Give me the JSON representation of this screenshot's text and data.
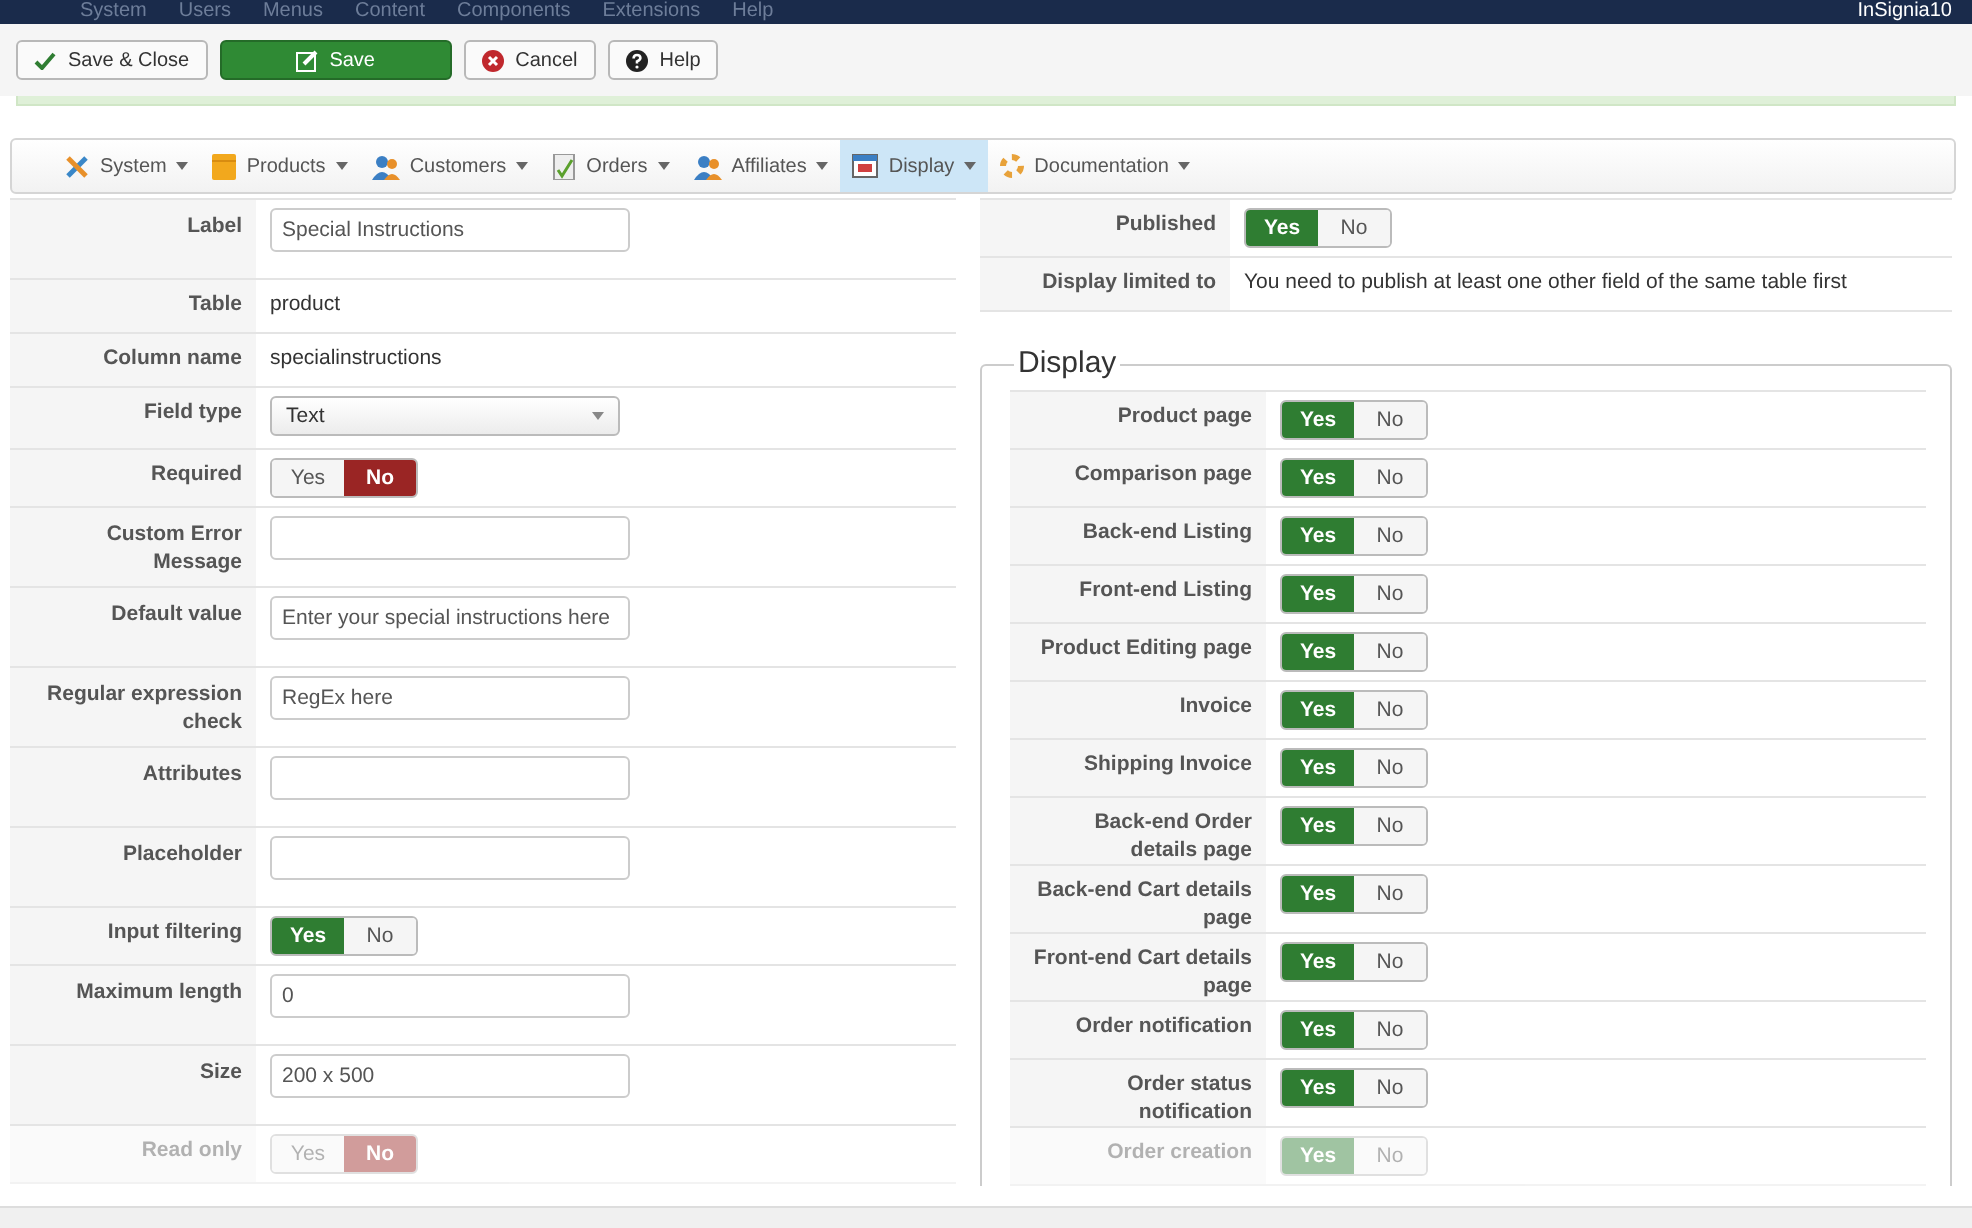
{
  "top_menu": {
    "items": [
      "System",
      "Users",
      "Menus",
      "Content",
      "Components",
      "Extensions",
      "Help"
    ],
    "user": "InSignia10"
  },
  "toolbar": [
    {
      "label": "Save & Close",
      "kind": "save-close"
    },
    {
      "label": "Save",
      "kind": "save"
    },
    {
      "label": "Cancel",
      "kind": "cancel"
    },
    {
      "label": "Help",
      "kind": "help"
    }
  ],
  "submenu": [
    {
      "label": "System",
      "kind": "tools",
      "selected": false
    },
    {
      "label": "Products",
      "kind": "box",
      "selected": false
    },
    {
      "label": "Customers",
      "kind": "people",
      "selected": false
    },
    {
      "label": "Orders",
      "kind": "document",
      "selected": false
    },
    {
      "label": "Affiliates",
      "kind": "people",
      "selected": false
    },
    {
      "label": "Display",
      "kind": "window",
      "selected": true
    },
    {
      "label": "Documentation",
      "kind": "lifebuoy",
      "selected": false
    }
  ],
  "field_form": [
    {
      "label": "Label",
      "kind": "input",
      "value": "Special Instructions",
      "disabled": false
    },
    {
      "label": "Table",
      "kind": "text",
      "value": "product",
      "disabled": false
    },
    {
      "label": "Column name",
      "kind": "text",
      "value": "specialinstructions",
      "disabled": false
    },
    {
      "label": "Field type",
      "kind": "select",
      "value": "Text",
      "disabled": false
    },
    {
      "label": "Required",
      "kind": "toggle",
      "options": [
        {
          "label": "Yes",
          "selected": false
        },
        {
          "label": "No",
          "selected": true
        }
      ],
      "disabled": false
    },
    {
      "label": "Custom Error Message",
      "kind": "input",
      "disabled": false
    },
    {
      "label": "Default value",
      "kind": "input",
      "value": "Enter your special instructions here",
      "disabled": false
    },
    {
      "label": "Regular expression check",
      "kind": "input",
      "value": "RegEx here",
      "disabled": false
    },
    {
      "label": "Attributes",
      "kind": "input",
      "disabled": false
    },
    {
      "label": "Placeholder",
      "kind": "input",
      "disabled": false
    },
    {
      "label": "Input filtering",
      "kind": "toggle",
      "options": [
        {
          "label": "Yes",
          "selected": true
        },
        {
          "label": "No",
          "selected": false
        }
      ],
      "disabled": false
    },
    {
      "label": "Maximum length",
      "kind": "input",
      "value": "0",
      "disabled": false
    },
    {
      "label": "Size",
      "kind": "input",
      "value": "200 x 500",
      "disabled": false
    },
    {
      "label": "Read only",
      "kind": "toggle",
      "options": [
        {
          "label": "Yes",
          "selected": false
        },
        {
          "label": "No",
          "selected": true
        }
      ],
      "disabled": true
    }
  ],
  "publishing": [
    {
      "label": "Published",
      "kind": "toggle",
      "options": [
        {
          "label": "Yes",
          "selected": true
        },
        {
          "label": "No",
          "selected": false
        }
      ],
      "disabled": false
    },
    {
      "label": "Display limited to",
      "kind": "text",
      "value": "You need to publish at least one other field of the same table first",
      "disabled": false
    }
  ],
  "display": {
    "title": "Display",
    "rows": [
      {
        "label": "Product page",
        "kind": "toggle",
        "options": [
          {
            "label": "Yes",
            "selected": true
          },
          {
            "label": "No",
            "selected": false
          }
        ],
        "disabled": false
      },
      {
        "label": "Comparison page",
        "kind": "toggle",
        "options": [
          {
            "label": "Yes",
            "selected": true
          },
          {
            "label": "No",
            "selected": false
          }
        ],
        "disabled": false
      },
      {
        "label": "Back-end Listing",
        "kind": "toggle",
        "options": [
          {
            "label": "Yes",
            "selected": true
          },
          {
            "label": "No",
            "selected": false
          }
        ],
        "disabled": false
      },
      {
        "label": "Front-end Listing",
        "kind": "toggle",
        "options": [
          {
            "label": "Yes",
            "selected": true
          },
          {
            "label": "No",
            "selected": false
          }
        ],
        "disabled": false
      },
      {
        "label": "Product Editing page",
        "kind": "toggle",
        "options": [
          {
            "label": "Yes",
            "selected": true
          },
          {
            "label": "No",
            "selected": false
          }
        ],
        "disabled": false
      },
      {
        "label": "Invoice",
        "kind": "toggle",
        "options": [
          {
            "label": "Yes",
            "selected": true
          },
          {
            "label": "No",
            "selected": false
          }
        ],
        "disabled": false
      },
      {
        "label": "Shipping Invoice",
        "kind": "toggle",
        "options": [
          {
            "label": "Yes",
            "selected": true
          },
          {
            "label": "No",
            "selected": false
          }
        ],
        "disabled": false
      },
      {
        "label": "Back-end Order details page",
        "kind": "toggle",
        "options": [
          {
            "label": "Yes",
            "selected": true
          },
          {
            "label": "No",
            "selected": false
          }
        ],
        "disabled": false
      },
      {
        "label": "Back-end Cart details page",
        "kind": "toggle",
        "options": [
          {
            "label": "Yes",
            "selected": true
          },
          {
            "label": "No",
            "selected": false
          }
        ],
        "disabled": false
      },
      {
        "label": "Front-end Cart details page",
        "kind": "toggle",
        "options": [
          {
            "label": "Yes",
            "selected": true
          },
          {
            "label": "No",
            "selected": false
          }
        ],
        "disabled": false
      },
      {
        "label": "Order notification",
        "kind": "toggle",
        "options": [
          {
            "label": "Yes",
            "selected": true
          },
          {
            "label": "No",
            "selected": false
          }
        ],
        "disabled": false
      },
      {
        "label": "Order status notification",
        "kind": "toggle",
        "options": [
          {
            "label": "Yes",
            "selected": true
          },
          {
            "label": "No",
            "selected": false
          }
        ],
        "disabled": false
      },
      {
        "label": "Order creation",
        "kind": "toggle",
        "options": [
          {
            "label": "Yes",
            "selected": true
          },
          {
            "label": "No",
            "selected": false
          }
        ],
        "disabled": true
      }
    ]
  }
}
